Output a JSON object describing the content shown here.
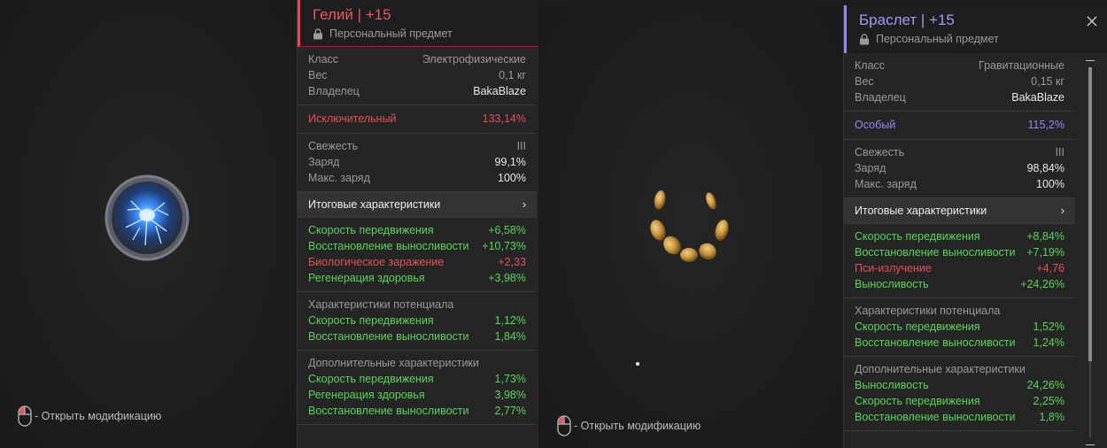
{
  "panel1": {
    "title": "Гелий | +15",
    "subtitle": "Персональный предмет",
    "info": [
      {
        "label": "Класс",
        "value": "Электрофизические"
      },
      {
        "label": "Вес",
        "value": "0,1 кг"
      },
      {
        "label": "Владелец",
        "value": "BakaBlaze"
      }
    ],
    "rarity": {
      "label": "Исключительный",
      "value": "133,14%"
    },
    "condition": [
      {
        "label": "Свежесть",
        "value": "III"
      },
      {
        "label": "Заряд",
        "value": "99,1%"
      },
      {
        "label": "Макс. заряд",
        "value": "100%"
      }
    ],
    "summary_label": "Итоговые характеристики",
    "summary_chevron": "›",
    "stats": [
      {
        "label": "Скорость передвижения",
        "value": "+6,58%"
      },
      {
        "label": "Восстановление выносливости",
        "value": "+10,73%"
      },
      {
        "label": "Биологическое заражение",
        "value": "+2,33"
      },
      {
        "label": "Регенерация здоровья",
        "value": "+3,98%"
      }
    ],
    "potential_title": "Характеристики потенциала",
    "potential": [
      {
        "label": "Скорость передвижения",
        "value": "1,12%"
      },
      {
        "label": "Восстановление выносливости",
        "value": "1,84%"
      }
    ],
    "additional_title": "Дополнительные характеристики",
    "additional": [
      {
        "label": "Скорость передвижения",
        "value": "1,73%"
      },
      {
        "label": "Регенерация здоровья",
        "value": "3,98%"
      },
      {
        "label": "Восстановление выносливости",
        "value": "2,77%"
      }
    ],
    "hint": "- Открыть модификацию"
  },
  "panel2": {
    "title": "Браслет | +15",
    "subtitle": "Персональный предмет",
    "info": [
      {
        "label": "Класс",
        "value": "Гравитационные"
      },
      {
        "label": "Вес",
        "value": "0,15 кг"
      },
      {
        "label": "Владелец",
        "value": "BakaBlaze"
      }
    ],
    "rarity": {
      "label": "Особый",
      "value": "115,2%"
    },
    "condition": [
      {
        "label": "Свежесть",
        "value": "III"
      },
      {
        "label": "Заряд",
        "value": "98,84%"
      },
      {
        "label": "Макс. заряд",
        "value": "100%"
      }
    ],
    "summary_label": "Итоговые характеристики",
    "summary_chevron": "›",
    "stats": [
      {
        "label": "Скорость передвижения",
        "value": "+8,84%"
      },
      {
        "label": "Восстановление выносливости",
        "value": "+7,19%"
      },
      {
        "label": "Пси-излучение",
        "value": "+4,76"
      },
      {
        "label": "Выносливость",
        "value": "+24,26%"
      }
    ],
    "potential_title": "Характеристики потенциала",
    "potential": [
      {
        "label": "Скорость передвижения",
        "value": "1,52%"
      },
      {
        "label": "Восстановление выносливости",
        "value": "1,24%"
      }
    ],
    "additional_title": "Дополнительные характеристики",
    "additional": [
      {
        "label": "Выносливость",
        "value": "24,26%"
      },
      {
        "label": "Скорость передвижения",
        "value": "2,25%"
      },
      {
        "label": "Восстановление выносливости",
        "value": "1,8%"
      }
    ],
    "hint": "- Открыть модификацию"
  },
  "colors": {
    "rarity_exceptional": "#ef5666",
    "rarity_special": "#8e8cf4",
    "positive": "#5cd45c",
    "negative": "#e6505a"
  },
  "icons": [
    "lock-icon",
    "mouse-icon",
    "close-icon",
    "chevron-right-icon"
  ]
}
